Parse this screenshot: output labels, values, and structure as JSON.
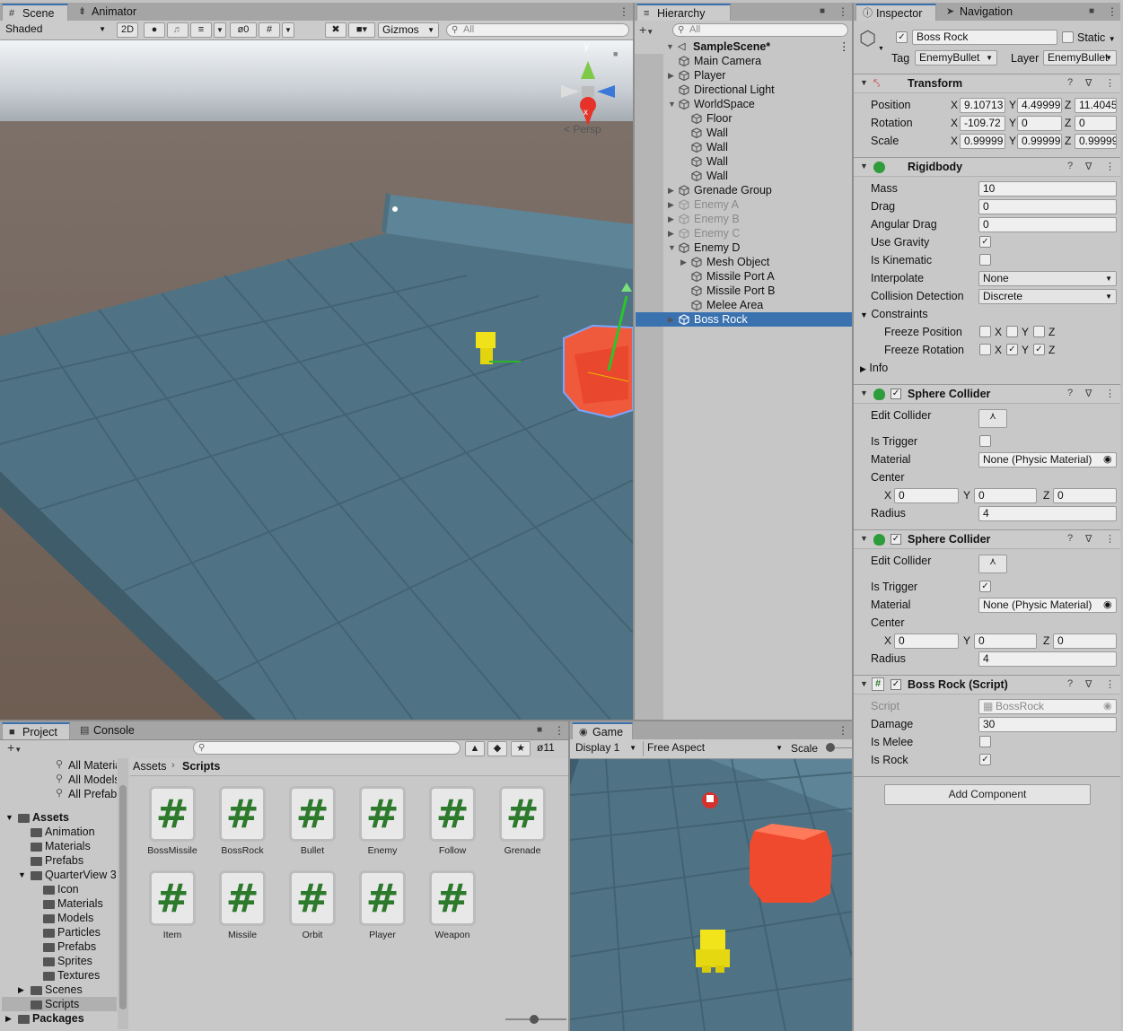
{
  "scene": {
    "tabs": [
      {
        "label": "Scene"
      },
      {
        "label": "Animator"
      }
    ],
    "shading_mode": "Shaded",
    "btn_2d": "2D",
    "hidden_count": "0",
    "gizmos_label": "Gizmos",
    "search_placeholder": "All",
    "gizmo_y": "y",
    "gizmo_x": "x",
    "persp_label": "Persp"
  },
  "hierarchy": {
    "tab": "Hierarchy",
    "search_placeholder": "All",
    "scene_name": "SampleScene*",
    "items": [
      {
        "label": "Main Camera"
      },
      {
        "label": "Player"
      },
      {
        "label": "Directional Light"
      },
      {
        "label": "WorldSpace"
      },
      {
        "label": "Floor"
      },
      {
        "label": "Wall"
      },
      {
        "label": "Wall"
      },
      {
        "label": "Wall"
      },
      {
        "label": "Wall"
      },
      {
        "label": "Grenade Group"
      },
      {
        "label": "Enemy A"
      },
      {
        "label": "Enemy B"
      },
      {
        "label": "Enemy C"
      },
      {
        "label": "Enemy D"
      },
      {
        "label": "Mesh Object"
      },
      {
        "label": "Missile Port A"
      },
      {
        "label": "Missile Port B"
      },
      {
        "label": "Melee Area"
      },
      {
        "label": "Boss Rock"
      }
    ]
  },
  "inspector": {
    "tabs": [
      {
        "label": "Inspector"
      },
      {
        "label": "Navigation"
      }
    ],
    "object_name": "Boss Rock",
    "static_label": "Static",
    "tag_label": "Tag",
    "tag_value": "EnemyBullet",
    "layer_label": "Layer",
    "layer_value": "EnemyBullet",
    "transform": {
      "title": "Transform",
      "position_label": "Position",
      "rotation_label": "Rotation",
      "scale_label": "Scale",
      "position": {
        "x": "9.10713",
        "y": "4.49999",
        "z": "11.4045"
      },
      "rotation": {
        "x": "-109.72",
        "y": "0",
        "z": "0"
      },
      "scale": {
        "x": "0.99999",
        "y": "0.99999",
        "z": "0.99999"
      }
    },
    "rigidbody": {
      "title": "Rigidbody",
      "mass_label": "Mass",
      "mass": "10",
      "drag_label": "Drag",
      "drag": "0",
      "angular_drag_label": "Angular Drag",
      "angular_drag": "0",
      "use_gravity_label": "Use Gravity",
      "is_kinematic_label": "Is Kinematic",
      "interpolate_label": "Interpolate",
      "interpolate": "None",
      "collision_detection_label": "Collision Detection",
      "collision_detection": "Discrete",
      "constraints_label": "Constraints",
      "freeze_position_label": "Freeze Position",
      "freeze_rotation_label": "Freeze Rotation",
      "info_label": "Info"
    },
    "sphere_collider_1": {
      "title": "Sphere Collider",
      "edit_collider_label": "Edit Collider",
      "is_trigger_label": "Is Trigger",
      "material_label": "Material",
      "material": "None (Physic Material)",
      "center_label": "Center",
      "center": {
        "x": "0",
        "y": "0",
        "z": "0"
      },
      "radius_label": "Radius",
      "radius": "4"
    },
    "sphere_collider_2": {
      "title": "Sphere Collider",
      "edit_collider_label": "Edit Collider",
      "is_trigger_label": "Is Trigger",
      "material_label": "Material",
      "material": "None (Physic Material)",
      "center_label": "Center",
      "center": {
        "x": "0",
        "y": "0",
        "z": "0"
      },
      "radius_label": "Radius",
      "radius": "4"
    },
    "boss_rock_script": {
      "title": "Boss Rock (Script)",
      "script_label": "Script",
      "script": "BossRock",
      "damage_label": "Damage",
      "damage": "30",
      "is_melee_label": "Is Melee",
      "is_rock_label": "Is Rock"
    },
    "add_component": "Add Component",
    "axes": {
      "x": "X",
      "y": "Y",
      "z": "Z"
    }
  },
  "project": {
    "tabs": [
      {
        "label": "Project"
      },
      {
        "label": "Console"
      }
    ],
    "hidden_count": "11",
    "breadcrumb_root": "Assets",
    "breadcrumb_current": "Scripts",
    "tree": [
      {
        "label": "All Materials"
      },
      {
        "label": "All Models"
      },
      {
        "label": "All Prefabs"
      },
      {
        "label": "Assets"
      },
      {
        "label": "Animation"
      },
      {
        "label": "Materials"
      },
      {
        "label": "Prefabs"
      },
      {
        "label": "QuarterView 3D"
      },
      {
        "label": "Icon"
      },
      {
        "label": "Materials"
      },
      {
        "label": "Models"
      },
      {
        "label": "Particles"
      },
      {
        "label": "Prefabs"
      },
      {
        "label": "Sprites"
      },
      {
        "label": "Textures"
      },
      {
        "label": "Scenes"
      },
      {
        "label": "Scripts"
      },
      {
        "label": "Packages"
      }
    ],
    "scripts": [
      {
        "label": "BossMissile"
      },
      {
        "label": "BossRock"
      },
      {
        "label": "Bullet"
      },
      {
        "label": "Enemy"
      },
      {
        "label": "Follow"
      },
      {
        "label": "Grenade"
      },
      {
        "label": "Item"
      },
      {
        "label": "Missile"
      },
      {
        "label": "Orbit"
      },
      {
        "label": "Player"
      },
      {
        "label": "Weapon"
      }
    ],
    "script_glyph": "#"
  },
  "game": {
    "tab": "Game",
    "display": "Display 1",
    "aspect": "Free Aspect",
    "scale_label": "Scale"
  }
}
